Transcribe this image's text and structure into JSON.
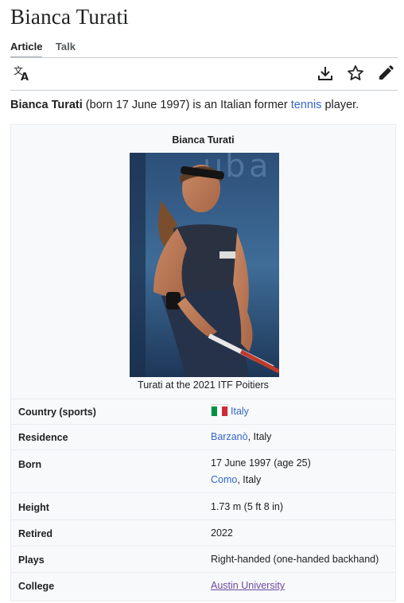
{
  "page": {
    "title": "Bianca Turati"
  },
  "tabs": [
    {
      "label": "Article"
    },
    {
      "label": "Talk"
    }
  ],
  "toolbar": {
    "language_icon": "translate-icon",
    "download_icon": "download-icon",
    "watch_icon": "star-icon",
    "edit_icon": "pencil-icon"
  },
  "lead": {
    "name": "Bianca Turati",
    "text_before_link": " (born 17 June 1997) is an Italian former ",
    "link": "tennis",
    "text_after_link": " player."
  },
  "infobox": {
    "title": "Bianca Turati",
    "caption": "Turati at the 2021 ITF Poitiers",
    "rows": [
      {
        "label": "Country (sports)",
        "value_link": "Italy",
        "flag_colors": [
          "#009246",
          "#ffffff",
          "#ce2b37"
        ]
      },
      {
        "label": "Residence",
        "value_link": "Barzanò",
        "value_text": ", Italy"
      },
      {
        "label": "Born",
        "value_line1": "17 June 1997 (age 25)",
        "value_link": "Como",
        "value_text": ", Italy"
      },
      {
        "label": "Height",
        "value": "1.73 m (5 ft 8 in)"
      },
      {
        "label": "Retired",
        "value": "2022"
      },
      {
        "label": "Plays",
        "value": "Right-handed (one-handed backhand)"
      },
      {
        "label": "College",
        "value_link": "Austin University"
      }
    ]
  },
  "colors": {
    "link": "#3366cc",
    "visited_link": "#6b4ba1",
    "infobox_bg": "#f8f9fa",
    "text": "#202122"
  }
}
